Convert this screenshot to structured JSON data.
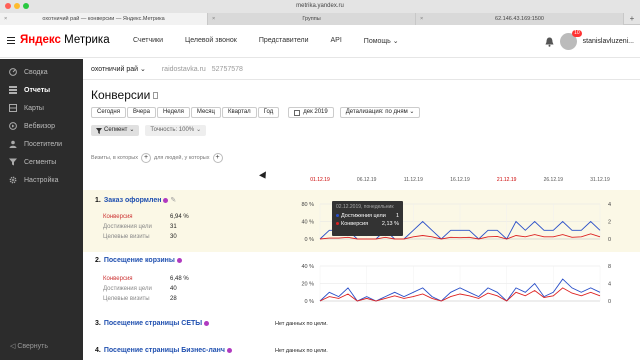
{
  "browser": {
    "url": "metrika.yandex.ru",
    "tabs": [
      {
        "label": "охотничий рай — конверсии — Яндекс.Метрика",
        "active": true
      },
      {
        "label": "Группы",
        "active": false
      },
      {
        "label": "62.146.43.169:1500",
        "active": false
      }
    ],
    "new_tab": "+"
  },
  "header": {
    "logo_yandex": "Яндекс",
    "logo_metrika": "Метрика",
    "nav": [
      "Счетчики",
      "Целевой звонок",
      "Представители",
      "API",
      "Помощь ⌄"
    ],
    "notifications_count": "10",
    "user": "stanislavluzeni..."
  },
  "sidebar": {
    "items": [
      {
        "label": "Сводка",
        "icon": "gauge-icon"
      },
      {
        "label": "Отчеты",
        "icon": "list-icon",
        "active": true
      },
      {
        "label": "Карты",
        "icon": "map-icon"
      },
      {
        "label": "Вебвизор",
        "icon": "play-icon"
      },
      {
        "label": "Посетители",
        "icon": "people-icon"
      },
      {
        "label": "Сегменты",
        "icon": "filter-icon"
      },
      {
        "label": "Настройка",
        "icon": "gear-icon"
      }
    ],
    "collapse": "Свернуть"
  },
  "subbar": {
    "counter": "охотничий рай ⌄",
    "site": "raidostavka.ru",
    "id": "52757578"
  },
  "page": {
    "title": "Конверсии"
  },
  "periods": [
    "Сегодня",
    "Вчера",
    "Неделя",
    "Месяц",
    "Квартал",
    "Год"
  ],
  "date_range": "дек 2019",
  "detail": "Детализация: по дням",
  "segment": "Сегмент",
  "accuracy": "Точность: 100%",
  "visits_label_1": "Визиты, в которых",
  "visits_label_2": "для людей, у которых",
  "date_axis": [
    {
      "label": "01.12.19",
      "red": true
    },
    {
      "label": "06.12.19",
      "red": false
    },
    {
      "label": "11.12.19",
      "red": false
    },
    {
      "label": "16.12.19",
      "red": false
    },
    {
      "label": "21.12.19",
      "red": true
    },
    {
      "label": "26.12.19",
      "red": false
    },
    {
      "label": "31.12.19",
      "red": false
    }
  ],
  "goals": [
    {
      "num": "1.",
      "name": "Заказ оформлен",
      "conv_label": "Конверсия",
      "conv": "6,94 %",
      "reach_label": "Достижения цели",
      "reach": "31",
      "visits_label": "Целевые визиты",
      "visits": "30",
      "axis_left": [
        "80 %",
        "40 %",
        "0 %"
      ],
      "axis_right": [
        "4",
        "2",
        "0"
      ]
    },
    {
      "num": "2.",
      "name": "Посещение корзины",
      "conv_label": "Конверсия",
      "conv": "6,48 %",
      "reach_label": "Достижения цели",
      "reach": "40",
      "visits_label": "Целевые визиты",
      "visits": "28",
      "axis_left": [
        "40 %",
        "20 %",
        "0 %"
      ],
      "axis_right": [
        "8",
        "4",
        "0"
      ]
    },
    {
      "num": "3.",
      "name": "Посещение страницы СЕТЫ",
      "nodata": "Нет данных по цели."
    },
    {
      "num": "4.",
      "name": "Посещение страницы Бизнес-ланч",
      "nodata": "Нет данных по цели."
    }
  ],
  "tooltip": {
    "title": "02.12.2019, понедельник",
    "rows": [
      {
        "label": "Достижения цели",
        "value": "1",
        "color": "#2a4fc8"
      },
      {
        "label": "Конверсия",
        "value": "2,13 %",
        "color": "#d22"
      }
    ]
  },
  "colors": {
    "blue": "#2a4fc8",
    "red": "#d22"
  },
  "series": {
    "g1_reach": [
      0,
      1,
      1,
      1,
      0,
      0,
      0,
      1,
      0,
      0,
      1,
      2,
      1,
      0,
      1,
      1,
      1,
      0,
      1,
      1,
      0,
      2,
      1,
      2,
      1,
      1,
      2,
      1,
      1,
      2,
      1
    ],
    "g1_conv": [
      0,
      0.02,
      0.02,
      0.04,
      0,
      0,
      0,
      0.04,
      0,
      0,
      0.05,
      0.08,
      0.05,
      0,
      0.04,
      0.03,
      0.04,
      0,
      0.05,
      0.06,
      0,
      0.08,
      0.05,
      0.1,
      0.05,
      0.05,
      0.1,
      0.04,
      0.05,
      0.12,
      0.05
    ],
    "g2_reach": [
      0,
      2,
      1,
      3,
      0,
      1,
      0,
      1,
      2,
      1,
      2,
      3,
      1,
      0,
      2,
      3,
      2,
      1,
      3,
      2,
      0,
      3,
      2,
      4,
      1,
      2,
      5,
      3,
      2,
      3,
      2
    ],
    "g2_conv": [
      0,
      0.05,
      0.03,
      0.08,
      0,
      0.03,
      0,
      0.03,
      0.06,
      0.03,
      0.05,
      0.08,
      0.03,
      0,
      0.05,
      0.08,
      0.06,
      0.03,
      0.09,
      0.06,
      0,
      0.1,
      0.06,
      0.12,
      0.04,
      0.06,
      0.15,
      0.09,
      0.06,
      0.1,
      0.06
    ]
  }
}
